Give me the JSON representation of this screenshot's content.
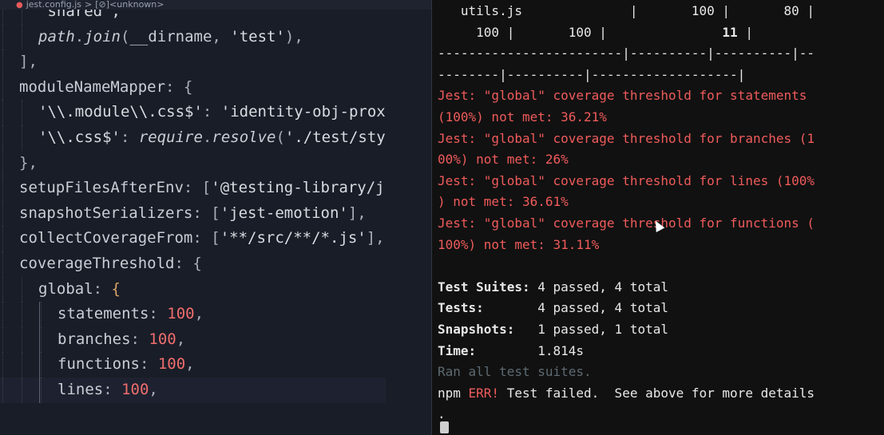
{
  "breadcrumb": {
    "file": "jest.config.js",
    "separator": ">",
    "symbol": "[⊘]<unknown>"
  },
  "editor": {
    "lines": [
      {
        "indent": 2,
        "segments": [
          {
            "c": "tok-str",
            "t": "'shared',"
          }
        ]
      },
      {
        "indent": 2,
        "segments": [
          {
            "c": "tok-ital",
            "t": "path"
          },
          {
            "c": "tok-punc",
            "t": "."
          },
          {
            "c": "tok-ital",
            "t": "join"
          },
          {
            "c": "tok-punc",
            "t": "("
          },
          {
            "c": "tok-key",
            "t": "__dirname"
          },
          {
            "c": "tok-punc",
            "t": ", "
          },
          {
            "c": "tok-str",
            "t": "'test'"
          },
          {
            "c": "tok-punc",
            "t": "),"
          }
        ]
      },
      {
        "indent": 1,
        "segments": [
          {
            "c": "tok-punc",
            "t": "],"
          }
        ]
      },
      {
        "indent": 1,
        "segments": [
          {
            "c": "tok-key",
            "t": "moduleNameMapper"
          },
          {
            "c": "tok-punc",
            "t": ": "
          },
          {
            "c": "tok-punc",
            "t": "{"
          }
        ]
      },
      {
        "indent": 2,
        "segments": [
          {
            "c": "tok-str",
            "t": "'\\\\.module\\\\.css$'"
          },
          {
            "c": "tok-punc",
            "t": ": "
          },
          {
            "c": "tok-str",
            "t": "'identity-obj-prox"
          }
        ]
      },
      {
        "indent": 2,
        "segments": [
          {
            "c": "tok-str",
            "t": "'\\\\.css$'"
          },
          {
            "c": "tok-punc",
            "t": ": "
          },
          {
            "c": "tok-ital",
            "t": "require"
          },
          {
            "c": "tok-punc",
            "t": "."
          },
          {
            "c": "tok-ital",
            "t": "resolve"
          },
          {
            "c": "tok-punc",
            "t": "("
          },
          {
            "c": "tok-str",
            "t": "'./test/sty"
          }
        ]
      },
      {
        "indent": 1,
        "segments": [
          {
            "c": "tok-punc",
            "t": "},"
          }
        ]
      },
      {
        "indent": 1,
        "segments": [
          {
            "c": "tok-key",
            "t": "setupFilesAfterEnv"
          },
          {
            "c": "tok-punc",
            "t": ": "
          },
          {
            "c": "tok-punc",
            "t": "["
          },
          {
            "c": "tok-str",
            "t": "'@testing-library/j"
          }
        ]
      },
      {
        "indent": 1,
        "segments": [
          {
            "c": "tok-key",
            "t": "snapshotSerializers"
          },
          {
            "c": "tok-punc",
            "t": ": "
          },
          {
            "c": "tok-punc",
            "t": "["
          },
          {
            "c": "tok-str",
            "t": "'jest-emotion'"
          },
          {
            "c": "tok-punc",
            "t": "],"
          }
        ]
      },
      {
        "indent": 1,
        "segments": [
          {
            "c": "tok-key",
            "t": "collectCoverageFrom"
          },
          {
            "c": "tok-punc",
            "t": ": "
          },
          {
            "c": "tok-punc",
            "t": "["
          },
          {
            "c": "tok-str",
            "t": "'**/src/**/*.js'"
          },
          {
            "c": "tok-punc",
            "t": "],"
          }
        ]
      },
      {
        "indent": 1,
        "segments": [
          {
            "c": "tok-key",
            "t": "coverageThreshold"
          },
          {
            "c": "tok-punc",
            "t": ": "
          },
          {
            "c": "tok-punc",
            "t": "{"
          }
        ]
      },
      {
        "indent": 2,
        "segments": [
          {
            "c": "tok-key",
            "t": "global"
          },
          {
            "c": "tok-punc",
            "t": ": "
          },
          {
            "c": "tok-brace",
            "t": "{"
          }
        ]
      },
      {
        "indent": 3,
        "active": true,
        "segments": [
          {
            "c": "tok-key",
            "t": "statements"
          },
          {
            "c": "tok-punc",
            "t": ": "
          },
          {
            "c": "tok-num",
            "t": "100"
          },
          {
            "c": "tok-punc",
            "t": ","
          }
        ]
      },
      {
        "indent": 3,
        "active": true,
        "segments": [
          {
            "c": "tok-key",
            "t": "branches"
          },
          {
            "c": "tok-punc",
            "t": ": "
          },
          {
            "c": "tok-num",
            "t": "100"
          },
          {
            "c": "tok-punc",
            "t": ","
          }
        ]
      },
      {
        "indent": 3,
        "active": true,
        "segments": [
          {
            "c": "tok-key",
            "t": "functions"
          },
          {
            "c": "tok-punc",
            "t": ": "
          },
          {
            "c": "tok-num",
            "t": "100"
          },
          {
            "c": "tok-punc",
            "t": ","
          }
        ]
      },
      {
        "indent": 3,
        "active": true,
        "current": true,
        "segments": [
          {
            "c": "tok-key",
            "t": "lines"
          },
          {
            "c": "tok-punc",
            "t": ": "
          },
          {
            "c": "tok-num",
            "t": "100"
          },
          {
            "c": "tok-punc",
            "t": ","
          }
        ]
      }
    ]
  },
  "terminal": {
    "lines": [
      {
        "row": 0,
        "segments": [
          {
            "c": "",
            "t": "   utils.js              |       100 |       80 |"
          }
        ]
      },
      {
        "row": 1,
        "segments": [
          {
            "c": "",
            "t": "     100 |       100 |               "
          },
          {
            "c": "t-bold",
            "t": "11"
          },
          {
            "c": "",
            "t": " |"
          }
        ]
      },
      {
        "row": 2,
        "segments": [
          {
            "c": "",
            "t": "------------------------|----------|----------|--"
          }
        ]
      },
      {
        "row": 3,
        "segments": [
          {
            "c": "",
            "t": "--------|----------|-------------------|"
          }
        ]
      },
      {
        "row": 4,
        "segments": [
          {
            "c": "t-red",
            "t": "Jest: \"global\" coverage threshold for statements"
          }
        ]
      },
      {
        "row": 5,
        "segments": [
          {
            "c": "t-red",
            "t": "(100%) not met: 36.21%"
          }
        ]
      },
      {
        "row": 6,
        "segments": [
          {
            "c": "t-red",
            "t": "Jest: \"global\" coverage threshold for branches (1"
          }
        ]
      },
      {
        "row": 7,
        "segments": [
          {
            "c": "t-red",
            "t": "00%) not met: 26%"
          }
        ]
      },
      {
        "row": 8,
        "segments": [
          {
            "c": "t-red",
            "t": "Jest: \"global\" coverage threshold for lines (100%"
          }
        ]
      },
      {
        "row": 9,
        "segments": [
          {
            "c": "t-red",
            "t": ") not met: 36.61%"
          }
        ]
      },
      {
        "row": 10,
        "segments": [
          {
            "c": "t-red",
            "t": "Jest: \"global\" coverage threshold for functions ("
          }
        ]
      },
      {
        "row": 11,
        "segments": [
          {
            "c": "t-red",
            "t": "100%) not met: 31.11%"
          }
        ]
      },
      {
        "row": 13,
        "segments": [
          {
            "c": "t-bold",
            "t": "Test Suites:"
          },
          {
            "c": "",
            "t": " 4 passed, 4 total"
          }
        ]
      },
      {
        "row": 14,
        "segments": [
          {
            "c": "t-bold",
            "t": "Tests:"
          },
          {
            "c": "",
            "t": "       4 passed, 4 total"
          }
        ]
      },
      {
        "row": 15,
        "segments": [
          {
            "c": "t-bold",
            "t": "Snapshots:"
          },
          {
            "c": "",
            "t": "   1 passed, 1 total"
          }
        ]
      },
      {
        "row": 16,
        "segments": [
          {
            "c": "t-bold",
            "t": "Time:"
          },
          {
            "c": "",
            "t": "        1.814s"
          }
        ]
      },
      {
        "row": 17,
        "segments": [
          {
            "c": "t-dim",
            "t": "Ran all test suites."
          }
        ]
      },
      {
        "row": 18,
        "segments": [
          {
            "c": "",
            "t": "npm "
          },
          {
            "c": "t-err",
            "t": "ERR!"
          },
          {
            "c": "",
            "t": " Test failed.  See above for more details"
          }
        ]
      },
      {
        "row": 19,
        "segments": [
          {
            "c": "",
            "t": "."
          }
        ]
      }
    ]
  }
}
